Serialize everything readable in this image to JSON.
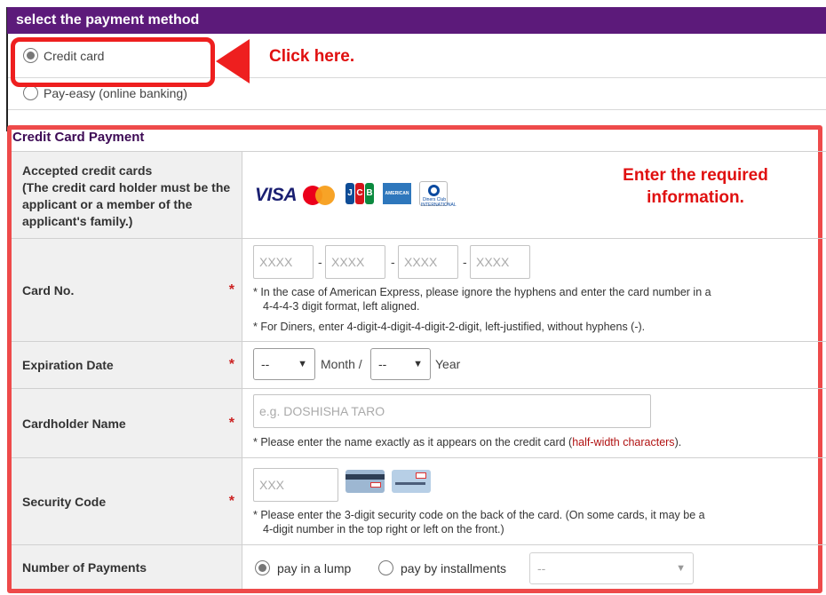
{
  "header": {
    "title": "select the payment method"
  },
  "payment_methods": [
    {
      "label": "Credit card",
      "checked": true
    },
    {
      "label": "Pay-easy (online banking)",
      "checked": false
    }
  ],
  "callouts": {
    "click": "Click here.",
    "enter_line1": "Enter the required",
    "enter_line2": "information."
  },
  "credit_card": {
    "section_title": "Credit Card Payment",
    "accepted": {
      "label": "Accepted credit cards",
      "label_note": "(The credit card holder must be the applicant or a member of the applicant's family.)",
      "logos": [
        "visa-logo",
        "mastercard-logo",
        "jcb-logo",
        "amex-logo",
        "diners-club-logo"
      ],
      "visa_text": "VISA",
      "jcb_text": [
        "J",
        "C",
        "B"
      ],
      "amex_text": "AMERICAN EXPRESS",
      "diners_text": "Diners Club INTERNATIONAL"
    },
    "card_no": {
      "label": "Card No.",
      "required_mark": "*",
      "placeholders": [
        "XXXX",
        "XXXX",
        "XXXX",
        "XXXX"
      ],
      "separator": "-",
      "note1_line1": "* In the case of American Express, please ignore the hyphens and enter the card number in a",
      "note1_line2": "4-4-4-3 digit format, left aligned.",
      "note2": "* For Diners, enter 4-digit-4-digit-4-digit-2-digit, left-justified, without hyphens (-)."
    },
    "expiration": {
      "label": "Expiration Date",
      "required_mark": "*",
      "month_value": "--",
      "month_suffix": "Month /",
      "year_value": "--",
      "year_suffix": "Year"
    },
    "cardholder": {
      "label": "Cardholder Name",
      "required_mark": "*",
      "placeholder": "e.g. DOSHISHA TARO",
      "note_pre": "* Please enter the name exactly as it appears on the credit card (",
      "note_red": "half-width characters",
      "note_post": ")."
    },
    "security": {
      "label": "Security Code",
      "required_mark": "*",
      "placeholder": "XXX",
      "note_line1": "* Please enter the 3-digit security code on the back of the card. (On some cards, it may be a",
      "note_line2": "4-digit number in the top right or left on the front.)"
    },
    "payments": {
      "label": "Number of Payments",
      "lump_label": "pay in a lump",
      "lump_checked": true,
      "installments_label": "pay by installments",
      "installments_checked": false,
      "installments_value": "--"
    }
  },
  "colors": {
    "header": "#5c1a7a",
    "highlight": "#ee1f1f",
    "required": "#cc2222"
  }
}
